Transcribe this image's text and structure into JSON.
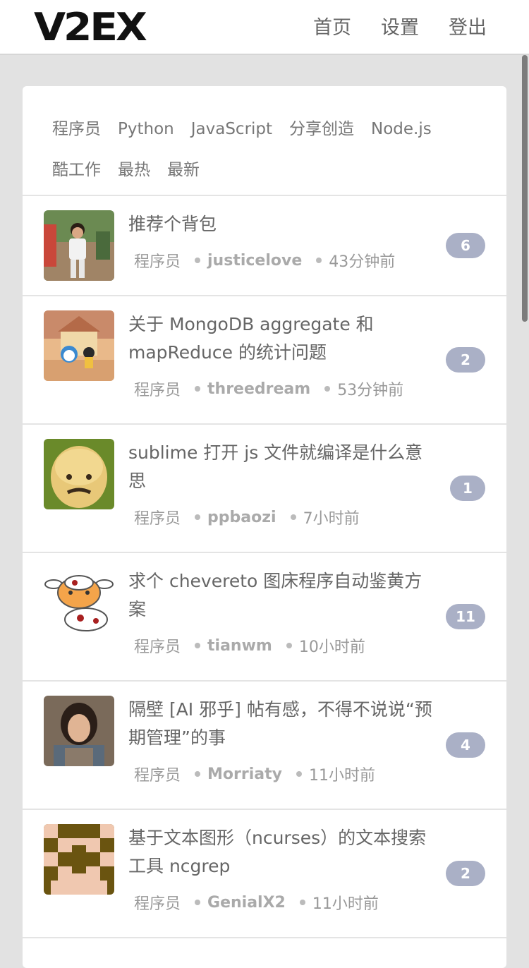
{
  "header": {
    "logo": "V2EX",
    "nav": [
      "首页",
      "设置",
      "登出"
    ]
  },
  "tabs": {
    "row1": [
      "程序员",
      "Python",
      "JavaScript",
      "分享创造",
      "Node.js"
    ],
    "row2": [
      "酷工作",
      "最热",
      "最新"
    ]
  },
  "topics": [
    {
      "title": "推荐个背包",
      "node": "程序员",
      "author": "justicelove",
      "time": "43分钟前",
      "replies": "6",
      "avatar": "photo-boy-avatar"
    },
    {
      "title": "关于 MongoDB aggregate 和 mapReduce 的统计问题",
      "node": "程序员",
      "author": "threedream",
      "time": "53分钟前",
      "replies": "2",
      "avatar": "doraemon-avatar"
    },
    {
      "title": "sublime 打开 js 文件就编译是什么意思",
      "node": "程序员",
      "author": "ppbaozi",
      "time": "7小时前",
      "replies": "1",
      "avatar": "bald-man-avatar"
    },
    {
      "title": "求个 chevereto 图床程序自动鉴黄方案",
      "node": "程序员",
      "author": "tianwm",
      "time": "10小时前",
      "replies": "11",
      "avatar": "cow-avatar"
    },
    {
      "title": "隔壁 [AI 邪乎] 帖有感，不得不说说“预期管理”的事",
      "node": "程序员",
      "author": "Morriaty",
      "time": "11小时前",
      "replies": "4",
      "avatar": "woman-photo-avatar"
    },
    {
      "title": "基于文本图形（ncurses）的文本搜索工具 ncgrep",
      "node": "程序员",
      "author": "GenialX2",
      "time": "11小时前",
      "replies": "2",
      "avatar": "pixel-pattern-avatar"
    }
  ],
  "colors": {
    "badge": "#aab0c6",
    "background": "#e2e2e2"
  }
}
